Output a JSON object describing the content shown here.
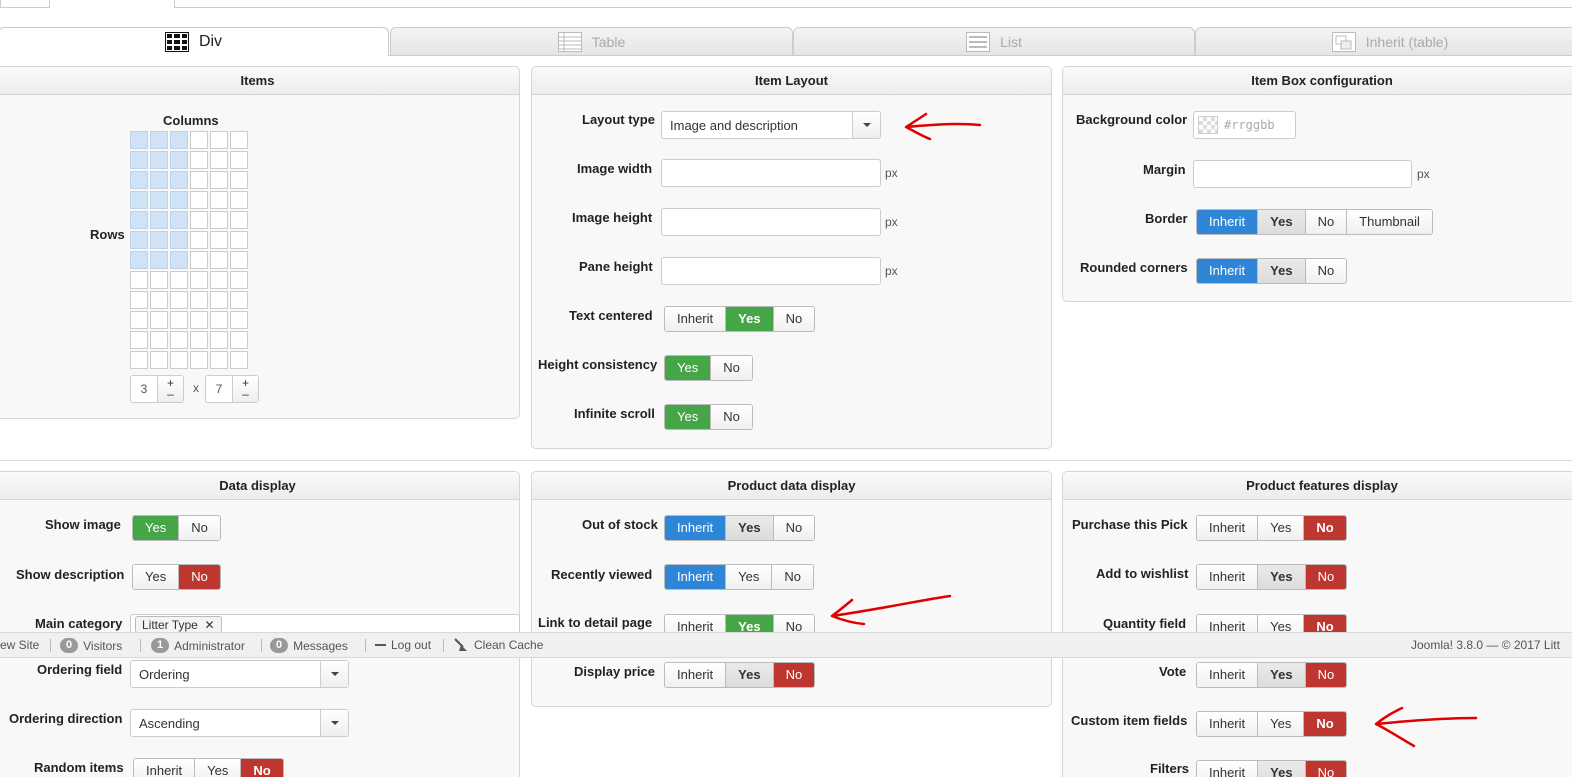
{
  "tabs": [
    {
      "label": "Div",
      "icon": "grid-icon",
      "active": true
    },
    {
      "label": "Table",
      "icon": "table-icon",
      "active": false
    },
    {
      "label": "List",
      "icon": "list-icon",
      "active": false
    },
    {
      "label": "Inherit (table)",
      "icon": "inherit-table-icon",
      "active": false
    }
  ],
  "items_panel": {
    "title": "Items",
    "columns_label": "Columns",
    "rows_label": "Rows",
    "columns_value": "3",
    "rows_value": "7",
    "times": "x",
    "grid_cols": 6,
    "grid_rows": 12,
    "sel_cols": 3,
    "sel_rows": 7
  },
  "item_layout": {
    "title": "Item Layout",
    "layout_type_label": "Layout type",
    "layout_type_value": "Image and description",
    "image_width_label": "Image width",
    "image_height_label": "Image height",
    "pane_height_label": "Pane height",
    "px": "px",
    "text_centered_label": "Text centered",
    "height_consistency_label": "Height consistency",
    "infinite_scroll_label": "Infinite scroll"
  },
  "item_box": {
    "title": "Item Box configuration",
    "bg_color_label": "Background color",
    "bg_color_placeholder": "#rrggbb",
    "margin_label": "Margin",
    "px": "px",
    "border_label": "Border",
    "rounded_label": "Rounded corners"
  },
  "data_display": {
    "title": "Data display",
    "show_image_label": "Show image",
    "show_description_label": "Show description",
    "main_category_label": "Main category",
    "main_category_tag": "Litter Type",
    "ordering_field_label": "Ordering field",
    "ordering_field_value": "Ordering",
    "ordering_direction_label": "Ordering direction",
    "ordering_direction_value": "Ascending",
    "random_items_label": "Random items"
  },
  "product_data_display": {
    "title": "Product data display",
    "out_of_stock_label": "Out of stock",
    "recently_viewed_label": "Recently viewed",
    "link_detail_label": "Link to detail page",
    "display_price_label": "Display price"
  },
  "product_features": {
    "title": "Product features display",
    "purchase_label": "Purchase this Pick",
    "wishlist_label": "Add to wishlist",
    "quantity_label": "Quantity field",
    "vote_label": "Vote",
    "custom_fields_label": "Custom item fields",
    "filters_label": "Filters"
  },
  "opts": {
    "inherit": "Inherit",
    "yes": "Yes",
    "no": "No",
    "thumbnail": "Thumbnail"
  },
  "statusbar": {
    "view_site": "ew Site",
    "visitors_count": "0",
    "visitors": "Visitors",
    "admins_count": "1",
    "administrator": "Administrator",
    "messages_count": "0",
    "messages": "Messages",
    "logout": "Log out",
    "clean_cache": "Clean Cache",
    "version": "Joomla! 3.8.0  —  © 2017 Litt"
  },
  "colors": {
    "green": "#46a546",
    "red": "#bd362f",
    "blue": "#2f86d6",
    "annotation": "#e00000"
  }
}
